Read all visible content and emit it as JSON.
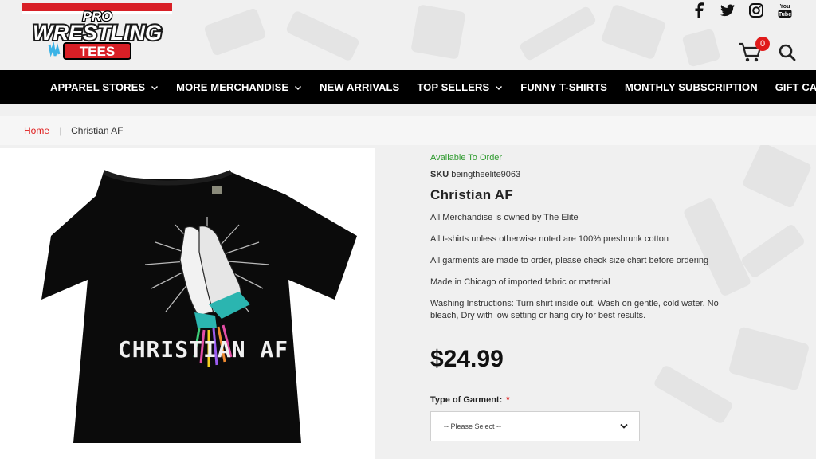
{
  "brand": {
    "logo_line1": "PRO",
    "logo_line2": "WRESTLING",
    "logo_line3": "TEES"
  },
  "social": [
    {
      "icon": "facebook-icon",
      "label": "f"
    },
    {
      "icon": "twitter-icon",
      "label": ""
    },
    {
      "icon": "instagram-icon",
      "label": ""
    },
    {
      "icon": "youtube-icon",
      "label": "You Tube"
    }
  ],
  "cart": {
    "count": "0"
  },
  "nav": {
    "items": [
      {
        "label": "APPAREL STORES",
        "dropdown": true
      },
      {
        "label": "MORE MERCHANDISE",
        "dropdown": true
      },
      {
        "label": "NEW ARRIVALS",
        "dropdown": false
      },
      {
        "label": "TOP SELLERS",
        "dropdown": true
      },
      {
        "label": "FUNNY T-SHIRTS",
        "dropdown": false
      },
      {
        "label": "MONTHLY SUBSCRIPTION",
        "dropdown": false
      },
      {
        "label": "GIFT CARDS",
        "dropdown": false
      }
    ]
  },
  "breadcrumb": {
    "home": "Home",
    "separator": "|",
    "current": "Christian AF"
  },
  "product": {
    "image_text": "CHRISTIAN AF",
    "availability": "Available To Order",
    "sku_label": "SKU",
    "sku_value": "beingtheelite9063",
    "title": "Christian AF",
    "info": [
      "All Merchandise is owned by The Elite",
      "All t-shirts unless otherwise noted are 100% preshrunk cotton",
      "All garments are made to order, please check size chart before ordering",
      "Made in Chicago of imported fabric or material",
      "Washing Instructions: Turn shirt inside out. Wash on gentle, cold water. No bleach, Dry with low setting or hang dry for best results."
    ],
    "price": "$24.99",
    "garment_label": "Type of Garment:",
    "required_mark": "*",
    "garment_select": "-- Please Select --"
  },
  "colors": {
    "accent": "#e01b1b",
    "available": "#2e9a2e",
    "navbar": "#000000"
  }
}
